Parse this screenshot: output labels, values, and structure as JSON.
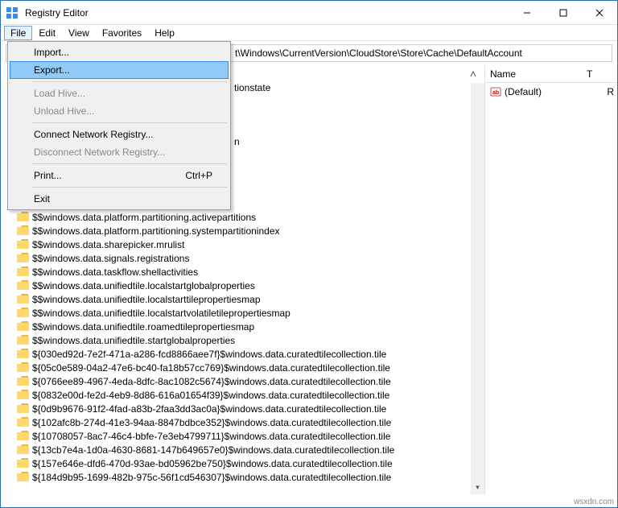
{
  "title": "Registry Editor",
  "menu": {
    "file": "File",
    "edit": "Edit",
    "view": "View",
    "favorites": "Favorites",
    "help": "Help"
  },
  "address": "t\\Windows\\CurrentVersion\\CloudStore\\Store\\Cache\\DefaultAccount",
  "dropdown": {
    "import": "Import...",
    "export": "Export...",
    "loadhive": "Load Hive...",
    "unloadhive": "Unload Hive...",
    "connect": "Connect Network Registry...",
    "disconnect": "Disconnect Network Registry...",
    "print": "Print...",
    "print_sc": "Ctrl+P",
    "exit": "Exit"
  },
  "peek1": "tionstate",
  "peek2": "n",
  "tree": [
    "$$windows.data.platform.partitioning.activepartitions",
    "$$windows.data.platform.partitioning.systempartitionindex",
    "$$windows.data.sharepicker.mrulist",
    "$$windows.data.signals.registrations",
    "$$windows.data.taskflow.shellactivities",
    "$$windows.data.unifiedtile.localstartglobalproperties",
    "$$windows.data.unifiedtile.localstarttilepropertiesmap",
    "$$windows.data.unifiedtile.localstartvolatiletilepropertiesmap",
    "$$windows.data.unifiedtile.roamedtilepropertiesmap",
    "$$windows.data.unifiedtile.startglobalproperties",
    "${030ed92d-7e2f-471a-a286-fcd8866aee7f}$windows.data.curatedtilecollection.tile",
    "${05c0e589-04a2-47e6-bc40-fa18b57cc769}$windows.data.curatedtilecollection.tile",
    "${0766ee89-4967-4eda-8dfc-8ac1082c5674}$windows.data.curatedtilecollection.tile",
    "${0832e00d-fe2d-4eb9-8d86-616a01654f39}$windows.data.curatedtilecollection.tile",
    "${0d9b9676-91f2-4fad-a83b-2faa3dd3ac0a}$windows.data.curatedtilecollection.tile",
    "${102afc8b-274d-41e3-94aa-8847bdbce352}$windows.data.curatedtilecollection.tile",
    "${10708057-8ac7-46c4-bbfe-7e3eb4799711}$windows.data.curatedtilecollection.tile",
    "${13cb7e4a-1d0a-4630-8681-147b649657e0}$windows.data.curatedtilecollection.tile",
    "${157e646e-dfd6-470d-93ae-bd05962be750}$windows.data.curatedtilecollection.tile",
    "${184d9b95-1699-482b-975c-56f1cd546307}$windows.data.curatedtilecollection.tile"
  ],
  "value_cols": {
    "name": "Name",
    "type": "T"
  },
  "value_default": "(Default)",
  "value_r": "R",
  "watermark": "wsxdn.com"
}
